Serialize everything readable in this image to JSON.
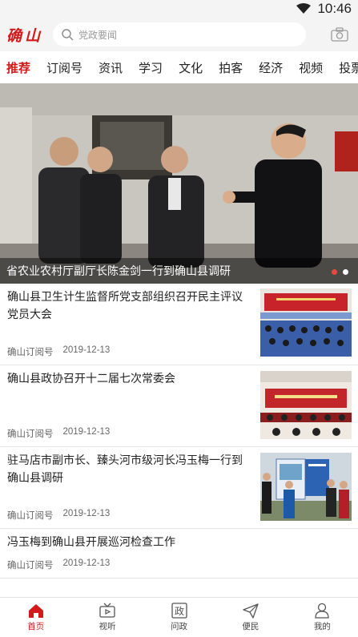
{
  "status_bar": {
    "time": "10:46"
  },
  "header": {
    "logo_text": "确山",
    "search_placeholder": "党政要闻"
  },
  "tabs": [
    "推荐",
    "订阅号",
    "资讯",
    "学习",
    "文化",
    "拍客",
    "经济",
    "视频",
    "投票"
  ],
  "active_tab": 0,
  "banner": {
    "caption": "省农业农村厅副厅长陈金剑一行到确山县调研",
    "slide_count": 2,
    "active_slide": 0
  },
  "news": [
    {
      "title": "确山县卫生计生监督所党支部组织召开民主评议党员大会",
      "source": "确山订阅号",
      "date": "2019-12-13",
      "has_thumb": true
    },
    {
      "title": "确山县政协召开十二届七次常委会",
      "source": "确山订阅号",
      "date": "2019-12-13",
      "has_thumb": true
    },
    {
      "title": "驻马店市副市长、臻头河市级河长冯玉梅一行到确山县调研",
      "source": "确山订阅号",
      "date": "2019-12-13",
      "has_thumb": true
    },
    {
      "title": "冯玉梅到确山县开展巡河检查工作",
      "source": "确山订阅号",
      "date": "2019-12-13",
      "has_thumb": false
    }
  ],
  "bottom_nav": [
    {
      "label": "首页",
      "icon": "home-icon",
      "active": true
    },
    {
      "label": "视听",
      "icon": "tv-icon",
      "active": false
    },
    {
      "label": "问政",
      "icon": "zheng-icon",
      "active": false
    },
    {
      "label": "便民",
      "icon": "send-icon",
      "active": false
    },
    {
      "label": "我的",
      "icon": "user-icon",
      "active": false
    }
  ],
  "bottom_nav_zheng_glyph": "政",
  "colors": {
    "accent": "#d11a1a",
    "status_bg": "#f4f4f4"
  }
}
